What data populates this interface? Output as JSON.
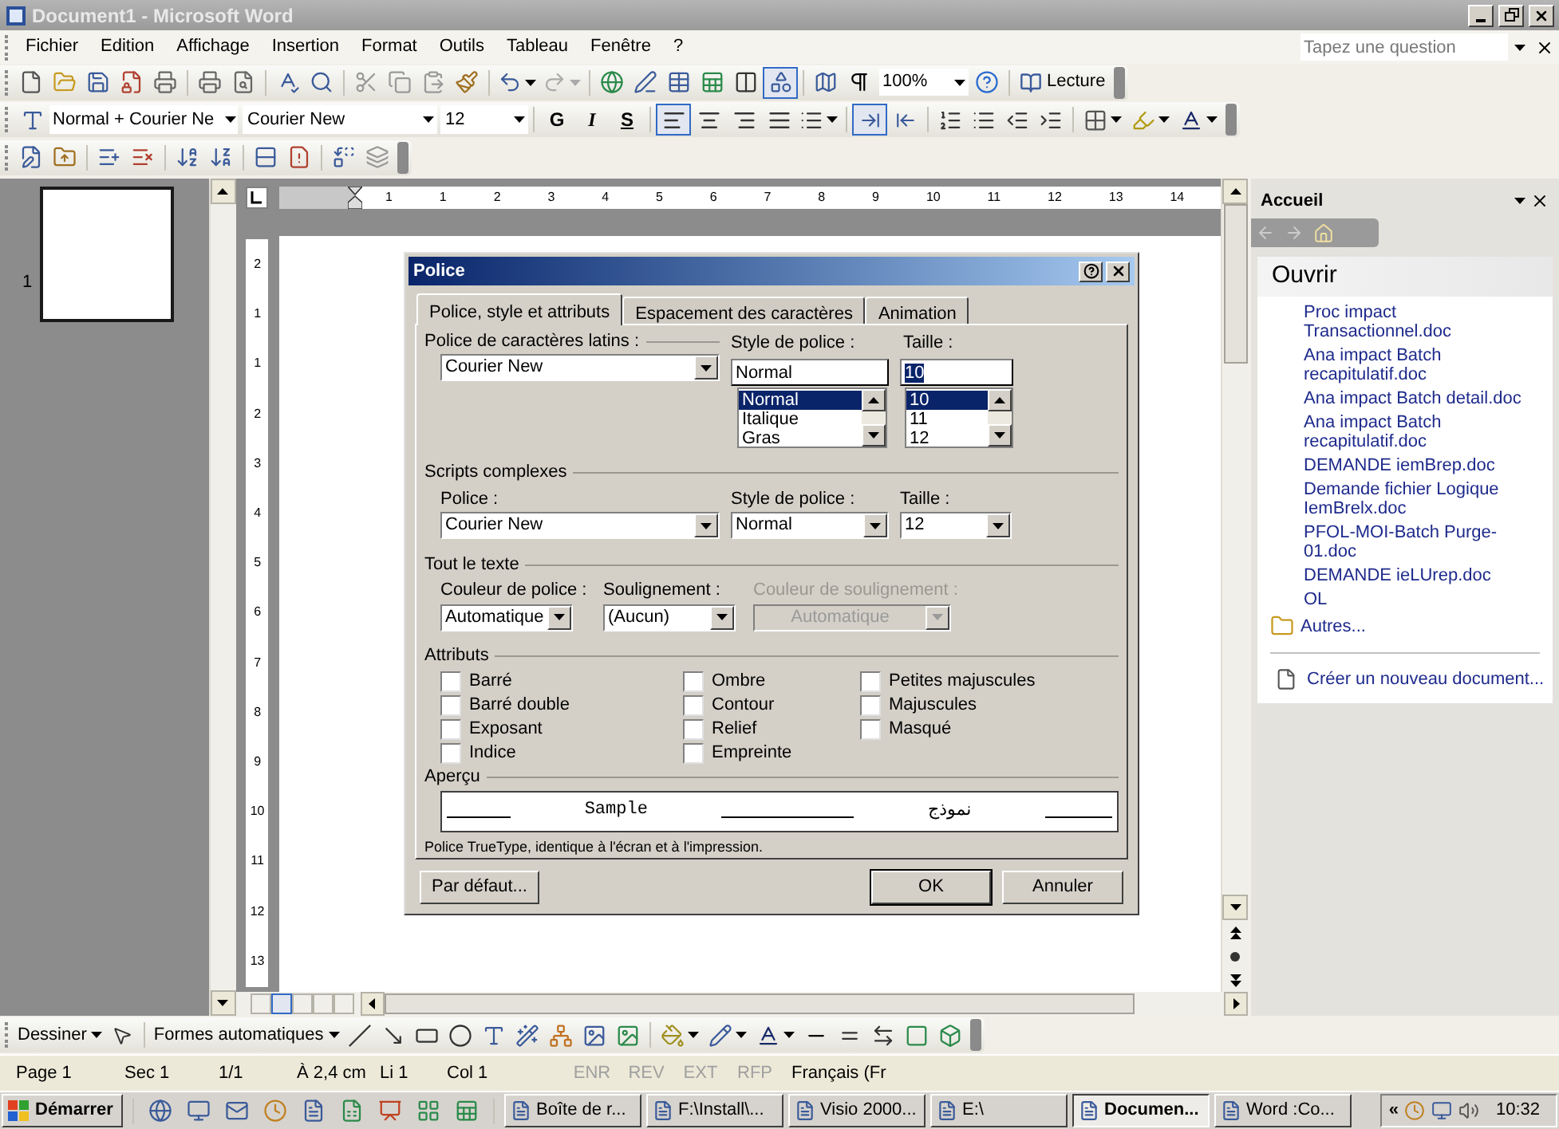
{
  "window": {
    "title": "Document1 - Microsoft Word"
  },
  "menu": [
    "Fichier",
    "Edition",
    "Affichage",
    "Insertion",
    "Format",
    "Outils",
    "Tableau",
    "Fenêtre",
    "?"
  ],
  "help_box": {
    "placeholder": "Tapez une question"
  },
  "standard_toolbar": {
    "zoom": "100%",
    "reading_button": "Lecture"
  },
  "formatting_toolbar": {
    "style": "Normal + Courier Ne",
    "font": "Courier New",
    "size": "12",
    "bold": "G",
    "italic": "I",
    "underline": "S",
    "alignments": [
      {
        "selected": true
      },
      {
        "selected": false
      },
      {
        "selected": false
      },
      {
        "selected": false
      }
    ],
    "directions": [
      {
        "selected": true
      },
      {
        "selected": false
      }
    ]
  },
  "thumbnails": [
    {
      "label": "1"
    }
  ],
  "ruler": {
    "numbers": [
      "1",
      "1",
      "2",
      "3",
      "4",
      "5",
      "6",
      "7",
      "8",
      "9",
      "10",
      "11",
      "12",
      "13",
      "14"
    ],
    "vertical_numbers": [
      "2",
      "1",
      "1",
      "2",
      "3",
      "4",
      "5",
      "6",
      "7",
      "8",
      "9",
      "10",
      "11",
      "12",
      "13"
    ]
  },
  "dialog": {
    "title": "Police",
    "tabs": [
      {
        "label": "Police, style et attributs",
        "selected": true
      },
      {
        "label": "Espacement des caractères",
        "selected": false
      },
      {
        "label": "Animation",
        "selected": false
      }
    ],
    "latin": {
      "heading": "Police de caractères latins :",
      "font": "Courier New",
      "style_label": "Style de police :",
      "style_value": "Normal",
      "style_options": [
        {
          "label": "Normal",
          "selected": true
        },
        {
          "label": "Italique",
          "selected": false
        },
        {
          "label": "Gras",
          "selected": false
        }
      ],
      "size_label": "Taille :",
      "size_value": "10",
      "size_options": [
        {
          "label": "10",
          "selected": true
        },
        {
          "label": "11",
          "selected": false
        },
        {
          "label": "12",
          "selected": false
        }
      ]
    },
    "complex": {
      "heading": "Scripts complexes",
      "font_label": "Police :",
      "font": "Courier New",
      "style_label": "Style de police :",
      "style": "Normal",
      "size_label": "Taille :",
      "size": "12"
    },
    "all_text": {
      "heading": "Tout le texte",
      "font_colour_label": "Couleur de police :",
      "font_colour": "Automatique",
      "underline_label": "Soulignement :",
      "underline": "(Aucun)",
      "underline_colour_label": "Couleur de soulignement :",
      "underline_colour": "Automatique",
      "underline_colour_disabled": true
    },
    "attributes": {
      "heading": "Attributs",
      "columns": [
        [
          {
            "label": "Barré",
            "checked": false
          },
          {
            "label": "Barré double",
            "checked": false
          },
          {
            "label": "Exposant",
            "checked": false
          },
          {
            "label": "Indice",
            "checked": false
          }
        ],
        [
          {
            "label": "Ombre",
            "checked": false
          },
          {
            "label": "Contour",
            "checked": false
          },
          {
            "label": "Relief",
            "checked": false
          },
          {
            "label": "Empreinte",
            "checked": false
          }
        ],
        [
          {
            "label": "Petites majuscules",
            "checked": false
          },
          {
            "label": "Majuscules",
            "checked": false
          },
          {
            "label": "Masqué",
            "checked": false
          }
        ]
      ]
    },
    "preview": {
      "heading": "Aperçu",
      "sample": "Sample",
      "arabic": "نموذج",
      "note": "Police TrueType, identique à l'écran et à l'impression."
    },
    "buttons": {
      "default": "Par défaut...",
      "ok": "OK",
      "cancel": "Annuler"
    }
  },
  "task_pane": {
    "title": "Accueil",
    "heading": "Ouvrir",
    "files": [
      "Proc impact Transactionnel.doc",
      "Ana impact Batch recapitulatif.doc",
      "Ana impact Batch detail.doc",
      "Ana impact Batch recapitulatif.doc",
      "DEMANDE iemBrep.doc",
      "Demande fichier Logique IemBrelx.doc",
      "PFOL-MOI-Batch Purge-01.doc",
      "DEMANDE ieLUrep.doc",
      "OL"
    ],
    "more": "Autres...",
    "new_document": "Créer un nouveau document..."
  },
  "drawing_toolbar": {
    "draw": "Dessiner",
    "autoshapes": "Formes automatiques"
  },
  "status_bar": {
    "fields": [
      "Page 1",
      "Sec 1",
      "1/1",
      "À 2,4 cm",
      "Li 1",
      "Col 1"
    ],
    "indicators": [
      {
        "label": "ENR",
        "disabled": true
      },
      {
        "label": "REV",
        "disabled": true
      },
      {
        "label": "EXT",
        "disabled": true
      },
      {
        "label": "RFP",
        "disabled": true
      }
    ],
    "language": "Français (Fr"
  },
  "taskbar": {
    "start": "Démarrer",
    "tasks": [
      {
        "label": "Boîte de r...",
        "selected": false
      },
      {
        "label": "F:\\Install\\...",
        "selected": false
      },
      {
        "label": "Visio 2000...",
        "selected": false
      },
      {
        "label": "E:\\",
        "selected": false
      },
      {
        "label": "Documen...",
        "selected": true
      },
      {
        "label": "Word :Co...",
        "selected": false
      }
    ],
    "tray_toggle": "«",
    "clock": "10:32"
  }
}
